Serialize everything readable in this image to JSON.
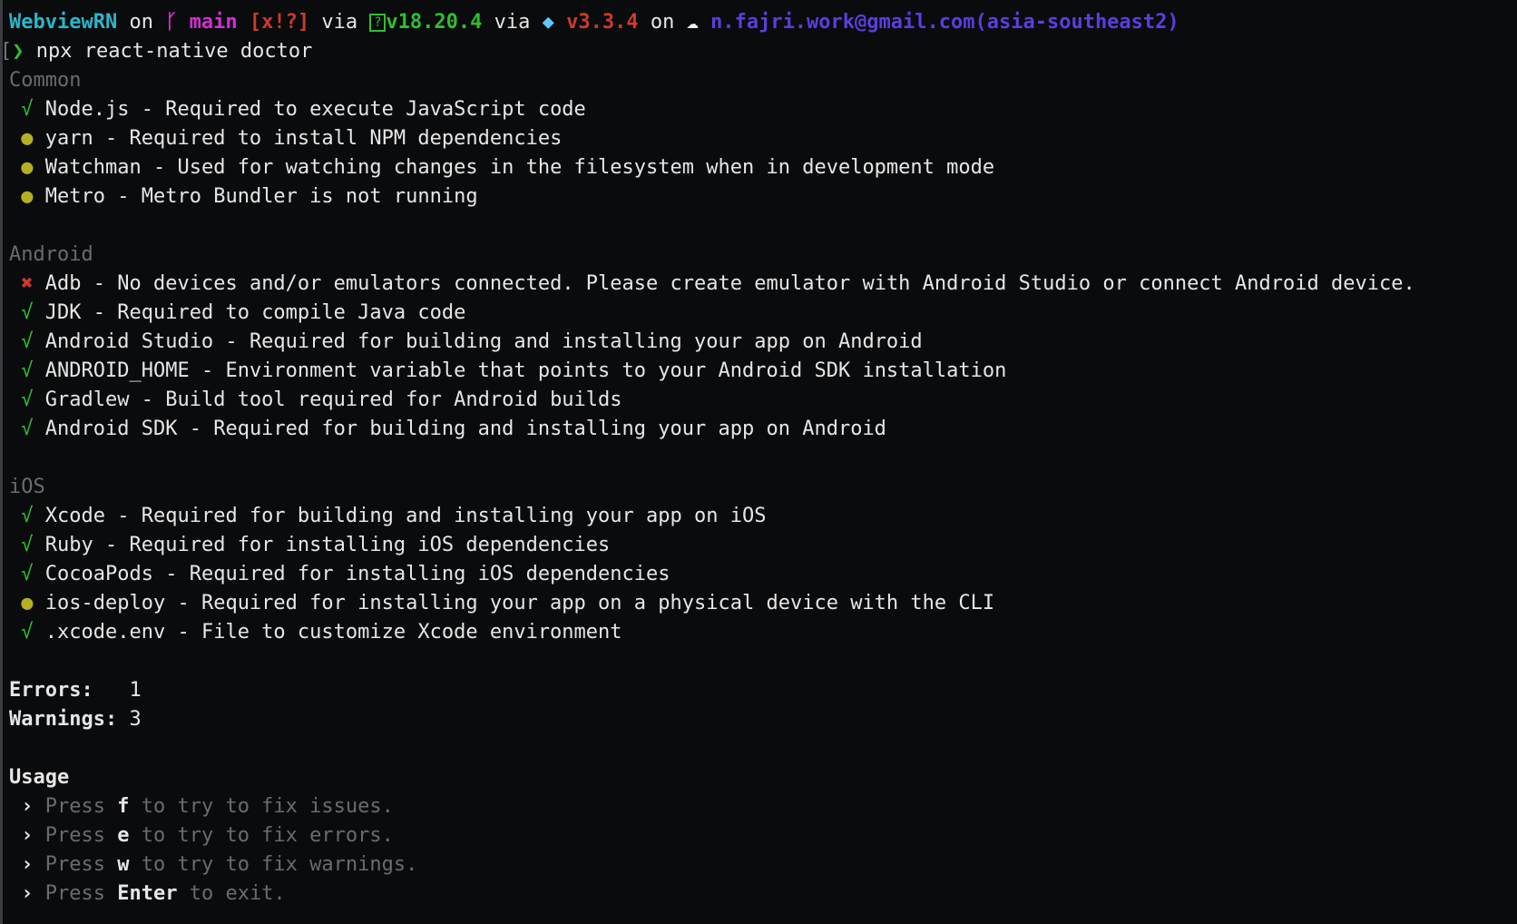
{
  "prompt": {
    "dir": "WebviewRN",
    "on1": "on",
    "branch_icon": "git-branch-icon",
    "branch": "main",
    "git_status": "[x!?]",
    "via1": "via",
    "node_icon": "node-icon",
    "node_version": "v18.20.4",
    "via2": "via",
    "ruby_icon": "gem-icon",
    "ruby_version": "v3.3.4",
    "on2": "on",
    "cloud_icon": "cloud-icon",
    "gcloud_account": "n.fajri.work@gmail.com(asia-southeast2)"
  },
  "command": {
    "chevron": "❯",
    "text": "npx react-native doctor"
  },
  "sections": [
    {
      "title": "Common",
      "items": [
        {
          "status": "ok",
          "mark": "√",
          "name": "Node.js",
          "desc": "Required to execute JavaScript code"
        },
        {
          "status": "warn",
          "mark": "●",
          "name": "yarn",
          "desc": "Required to install NPM dependencies"
        },
        {
          "status": "warn",
          "mark": "●",
          "name": "Watchman",
          "desc": "Used for watching changes in the filesystem when in development mode"
        },
        {
          "status": "warn",
          "mark": "●",
          "name": "Metro",
          "desc": "Metro Bundler is not running"
        }
      ]
    },
    {
      "title": "Android",
      "items": [
        {
          "status": "err",
          "mark": "✖",
          "name": "Adb",
          "desc": "No devices and/or emulators connected. Please create emulator with Android Studio or connect Android device."
        },
        {
          "status": "ok",
          "mark": "√",
          "name": "JDK",
          "desc": "Required to compile Java code"
        },
        {
          "status": "ok",
          "mark": "√",
          "name": "Android Studio",
          "desc": "Required for building and installing your app on Android"
        },
        {
          "status": "ok",
          "mark": "√",
          "name": "ANDROID_HOME",
          "desc": "Environment variable that points to your Android SDK installation"
        },
        {
          "status": "ok",
          "mark": "√",
          "name": "Gradlew",
          "desc": "Build tool required for Android builds"
        },
        {
          "status": "ok",
          "mark": "√",
          "name": "Android SDK",
          "desc": "Required for building and installing your app on Android"
        }
      ]
    },
    {
      "title": "iOS",
      "items": [
        {
          "status": "ok",
          "mark": "√",
          "name": "Xcode",
          "desc": "Required for building and installing your app on iOS"
        },
        {
          "status": "ok",
          "mark": "√",
          "name": "Ruby",
          "desc": "Required for installing iOS dependencies"
        },
        {
          "status": "ok",
          "mark": "√",
          "name": "CocoaPods",
          "desc": "Required for installing iOS dependencies"
        },
        {
          "status": "warn",
          "mark": "●",
          "name": "ios-deploy",
          "desc": "Required for installing your app on a physical device with the CLI"
        },
        {
          "status": "ok",
          "mark": "√",
          "name": ".xcode.env",
          "desc": "File to customize Xcode environment"
        }
      ]
    }
  ],
  "summary": {
    "errors_label": "Errors:",
    "errors": "1",
    "warnings_label": "Warnings:",
    "warnings": "3"
  },
  "usage": {
    "title": "Usage",
    "bullet": "›",
    "lines": [
      {
        "pre": "Press",
        "key": "f",
        "post": "to try to fix issues."
      },
      {
        "pre": "Press",
        "key": "e",
        "post": "to try to fix errors."
      },
      {
        "pre": "Press",
        "key": "w",
        "post": "to try to fix warnings."
      },
      {
        "pre": "Press",
        "key": "Enter",
        "post": "to exit."
      }
    ]
  },
  "colors": {
    "ok": "#2fbf2f",
    "warn": "#b5b021",
    "err": "#d0392b",
    "background": "#0a0b0d"
  }
}
